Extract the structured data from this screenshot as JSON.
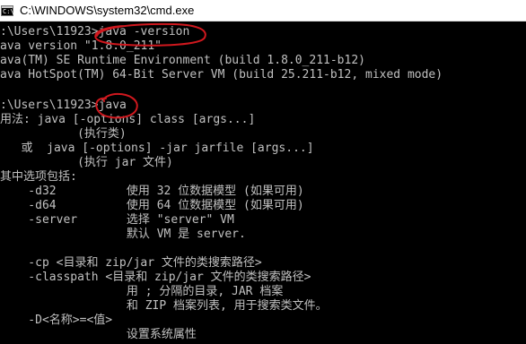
{
  "window": {
    "title": "C:\\WINDOWS\\system32\\cmd.exe",
    "icon": "cmd-icon"
  },
  "console": {
    "lines": [
      ":\\Users\\11923>java -version",
      "ava version \"1.8.0_211\"",
      "ava(TM) SE Runtime Environment (build 1.8.0_211-b12)",
      "ava HotSpot(TM) 64-Bit Server VM (build 25.211-b12, mixed mode)",
      "",
      ":\\Users\\11923>java",
      "用法: java [-options] class [args...]",
      "           (执行类)",
      "   或  java [-options] -jar jarfile [args...]",
      "           (执行 jar 文件)",
      "其中选项包括:",
      "    -d32          使用 32 位数据模型 (如果可用)",
      "    -d64          使用 64 位数据模型 (如果可用)",
      "    -server       选择 \"server\" VM",
      "                  默认 VM 是 server.",
      "",
      "    -cp <目录和 zip/jar 文件的类搜索路径>",
      "    -classpath <目录和 zip/jar 文件的类搜索路径>",
      "                  用 ; 分隔的目录, JAR 档案",
      "                  和 ZIP 档案列表, 用于搜索类文件。",
      "    -D<名称>=<值>",
      "                  设置系统属性"
    ]
  },
  "colors": {
    "background": "#000000",
    "text": "#c0c0c0",
    "annotation": "#d0181e",
    "titlebar": "#ffffff"
  }
}
